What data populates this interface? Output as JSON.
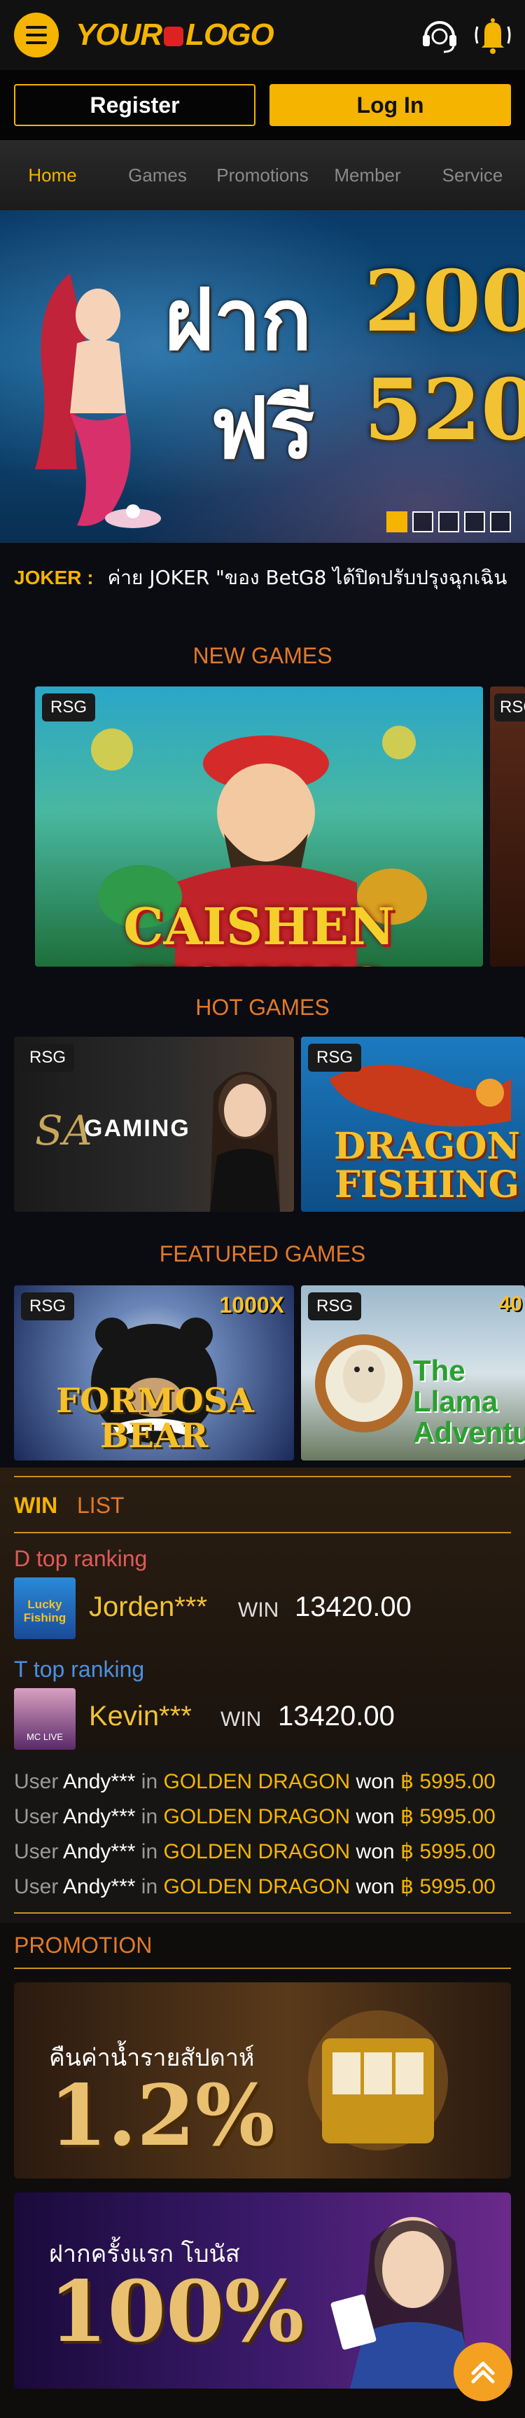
{
  "header": {
    "logo_text_left": "YOUR",
    "logo_text_right": "LOGO",
    "menu_icon": "hamburger-menu-icon",
    "support_icon": "headset-icon",
    "bell_icon": "bell-icon"
  },
  "auth": {
    "register_label": "Register",
    "login_label": "Log In"
  },
  "nav": {
    "items": [
      "Home",
      "Games",
      "Promotions",
      "Member",
      "Service"
    ]
  },
  "banner": {
    "line1": "ฝาก",
    "line1_num": "200",
    "line2": "ฟรี",
    "line2_num": "520",
    "slide_count": 5,
    "active_slide": 1
  },
  "marquee": {
    "label": "JOKER :",
    "text": "ค่าย JOKER \"ของ BetG8 ได้ปิดปรับปรุงฉุกเฉิน"
  },
  "new_games": {
    "title": "NEW GAMES",
    "tiles": [
      {
        "badge": "RSG",
        "name": "CAISHEN FISHING"
      },
      {
        "badge": "RSG",
        "name": ""
      }
    ]
  },
  "hot_games": {
    "title": "HOT GAMES",
    "tiles": [
      {
        "badge": "RSG",
        "name": "GAMING",
        "brand": "SA"
      },
      {
        "badge": "RSG",
        "name": "DRAGON FISHING"
      }
    ]
  },
  "featured_games": {
    "title": "FEATURED GAMES",
    "tiles": [
      {
        "badge": "RSG",
        "name": "FORMOSA BEAR",
        "multiplier": "1000X"
      },
      {
        "badge": "RSG",
        "name": "The Llama Adventure",
        "multiplier": "40"
      }
    ]
  },
  "win_list": {
    "tab_win": "WIN",
    "tab_list": "LIST",
    "d_heading": "D top ranking",
    "d_entry": {
      "name": "Jorden***",
      "win_label": "WIN",
      "amount": "13420.00",
      "thumb_label": "Lucky Fishing"
    },
    "t_heading": "T top ranking",
    "t_entry": {
      "name": "Kevin***",
      "win_label": "WIN",
      "amount": "13420.00",
      "thumb_label": "MC LIVE"
    }
  },
  "feed": {
    "rows": [
      {
        "user_label": "User",
        "user": "Andy***",
        "in_label": "in",
        "game": "GOLDEN DRAGON",
        "won_label": "won",
        "amount": "฿ 5995.00"
      },
      {
        "user_label": "User",
        "user": "Andy***",
        "in_label": "in",
        "game": "GOLDEN DRAGON",
        "won_label": "won",
        "amount": "฿ 5995.00"
      },
      {
        "user_label": "User",
        "user": "Andy***",
        "in_label": "in",
        "game": "GOLDEN DRAGON",
        "won_label": "won",
        "amount": "฿ 5995.00"
      },
      {
        "user_label": "User",
        "user": "Andy***",
        "in_label": "in",
        "game": "GOLDEN DRAGON",
        "won_label": "won",
        "amount": "฿ 5995.00"
      }
    ]
  },
  "promotion": {
    "title": "PROMOTION",
    "banners": [
      {
        "caption": "คืนค่าน้ำรายสัปดาห์",
        "value": "1.2%"
      },
      {
        "caption": "ฝากครั้งแรก โบนัส",
        "value": "100%"
      }
    ]
  },
  "colors": {
    "accent": "#f4b400",
    "section_title": "#e07a2a",
    "d_rank": "#e05a5a",
    "t_rank": "#4a90e2"
  },
  "scroll_top_icon": "chevron-up-icon"
}
